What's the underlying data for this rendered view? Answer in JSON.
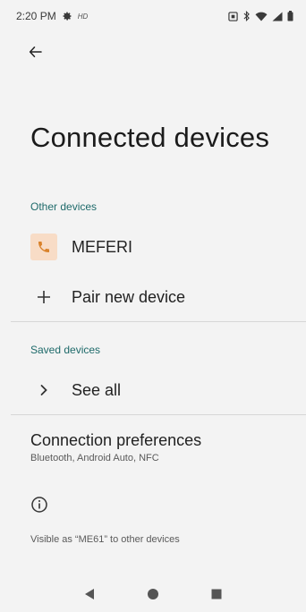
{
  "status_bar": {
    "time": "2:20 PM",
    "hd": "HD",
    "icons": [
      "gear-icon",
      "nfc-icon",
      "bluetooth-icon",
      "wifi-icon",
      "signal-icon",
      "battery-icon"
    ]
  },
  "page": {
    "title": "Connected devices"
  },
  "other_devices": {
    "header": "Other devices",
    "items": [
      {
        "label": "MEFERI",
        "icon": "phone-icon",
        "icon_bg": "#f8dcc6",
        "icon_color": "#d9822b"
      }
    ],
    "pair_label": "Pair new device"
  },
  "saved_devices": {
    "header": "Saved devices",
    "see_all_label": "See all"
  },
  "connection_preferences": {
    "title": "Connection preferences",
    "subtitle": "Bluetooth, Android Auto, NFC"
  },
  "footer": {
    "visible_as": "Visible as “ME61” to other devices"
  },
  "colors": {
    "accent": "#1e6a6a",
    "background": "#f3f3f3"
  }
}
